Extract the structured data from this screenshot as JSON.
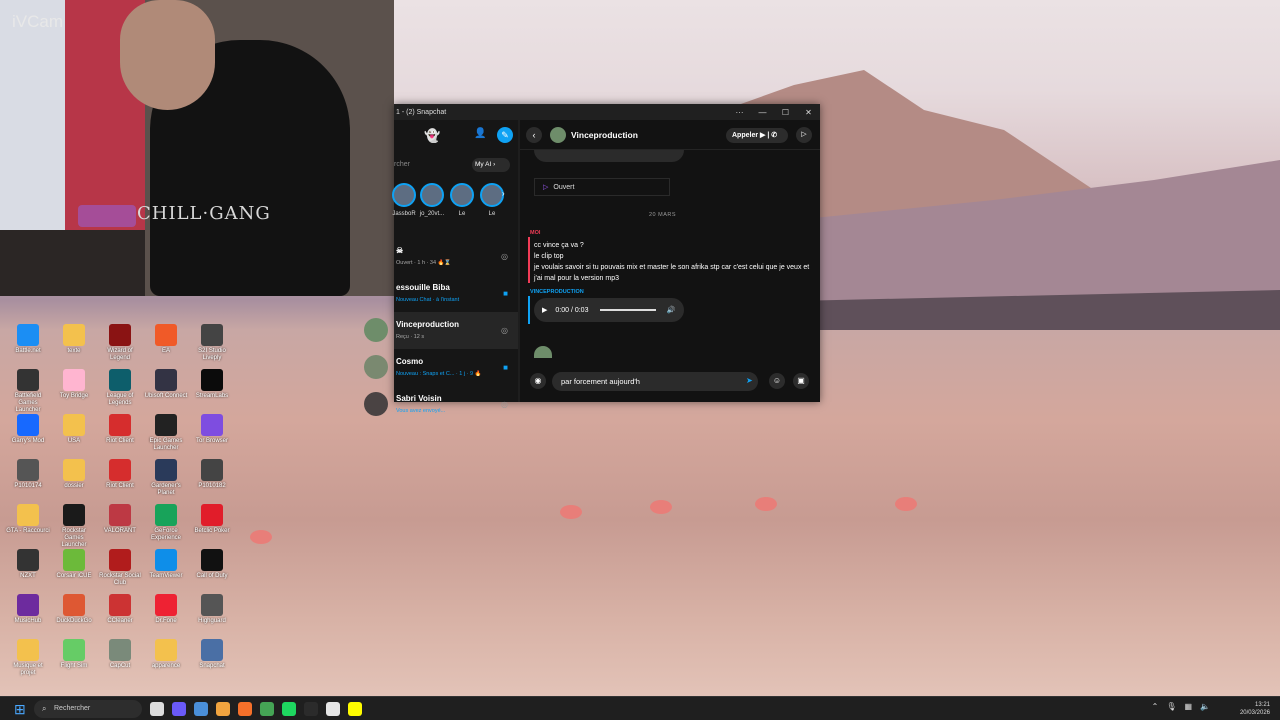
{
  "webcam": {
    "label": "iVCam",
    "shirt_text": "CHILL·GANG"
  },
  "desktop": {
    "icons": [
      {
        "label": "Battle.net",
        "color": "#1b8ef4"
      },
      {
        "label": "texte",
        "color": "#f3c14d"
      },
      {
        "label": "Wizard of Legend",
        "color": "#8a1313"
      },
      {
        "label": "EA",
        "color": "#f05a28"
      },
      {
        "label": "S2I Studio Liveply",
        "color": "#444"
      },
      {
        "label": "Battlefield Games Launcher",
        "color": "#333"
      },
      {
        "label": "Toy Bridge",
        "color": "#ffb5d0"
      },
      {
        "label": "League of Legends",
        "color": "#0d5e6b"
      },
      {
        "label": "Ubisoft Connect",
        "color": "#334"
      },
      {
        "label": "StreamLabs",
        "color": "#0b0b0b"
      },
      {
        "label": "Garry's Mod",
        "color": "#1769ff"
      },
      {
        "label": "USA",
        "color": "#f3c14d"
      },
      {
        "label": "Riot Client",
        "color": "#d62d2d"
      },
      {
        "label": "Epic Games Launcher",
        "color": "#222"
      },
      {
        "label": "Tor Browser",
        "color": "#7e4de0"
      },
      {
        "label": "P1010174",
        "color": "#555"
      },
      {
        "label": "dossier",
        "color": "#f3c14d"
      },
      {
        "label": "Riot Client",
        "color": "#d62d2d"
      },
      {
        "label": "Gardener's Planet",
        "color": "#2a3a5a"
      },
      {
        "label": "P1010182",
        "color": "#444"
      },
      {
        "label": "GTA - Raccourci",
        "color": "#f3c14d"
      },
      {
        "label": "Rockstar Games Launcher",
        "color": "#1a1a1a"
      },
      {
        "label": "VALORANT",
        "color": "#bd3944"
      },
      {
        "label": "GeForce Experience",
        "color": "#18a35a"
      },
      {
        "label": "Betclic Poker",
        "color": "#e11d2a"
      },
      {
        "label": "NZXT",
        "color": "#333"
      },
      {
        "label": "Corsair iCUE",
        "color": "#6cba3a"
      },
      {
        "label": "Rockstar Social Club",
        "color": "#b11c1c"
      },
      {
        "label": "TeamViewer",
        "color": "#0e8ee9"
      },
      {
        "label": "Call of Duty",
        "color": "#111"
      },
      {
        "label": "MusicHub",
        "color": "#6d2b9e"
      },
      {
        "label": "DuckDuckGo",
        "color": "#de5833"
      },
      {
        "label": "CCleaner",
        "color": "#c33"
      },
      {
        "label": "Dr.Fone",
        "color": "#e23"
      },
      {
        "label": "Highguard",
        "color": "#555"
      },
      {
        "label": "Musique et projet",
        "color": "#f3c14d"
      },
      {
        "label": "Flight Sim",
        "color": "#6c6"
      },
      {
        "label": "CapCut",
        "color": "#7a8a7a"
      },
      {
        "label": "apparence",
        "color": "#f3c14d"
      },
      {
        "label": "Snapchat",
        "color": "#4a6fa5"
      }
    ]
  },
  "snapchat": {
    "title": "1 - (2) Snapchat",
    "window_controls": [
      "···",
      "—",
      "☐",
      "✕"
    ],
    "search_placeholder": "rcher",
    "myai_label": "My AI",
    "stories": [
      {
        "name": "JassboR"
      },
      {
        "name": "jo_20vt..."
      },
      {
        "name": "Le"
      },
      {
        "name": "Le"
      }
    ],
    "chats": [
      {
        "name": "☠",
        "status": "Ouvert · 1 h · 34 🔥⌛"
      },
      {
        "name": "essouille Biba",
        "status": "Nouveau Chat · à l'instant"
      },
      {
        "name": "Vinceproduction",
        "status": "Reçu · 12 s"
      },
      {
        "name": "Cosmo",
        "status": "Nouveau : Snaps et C... · 1 j · 9 🔥"
      },
      {
        "name": "Sabri Voisin",
        "status": "Vous avez envoyé..."
      }
    ],
    "conversation": {
      "contact": "Vinceproduction",
      "call_label": "Appeler",
      "opened_label": "Ouvert",
      "date_divider": "20 MARS",
      "me_label": "MOI",
      "my_message": "cc vince ça va ?\nle clip top\nje voulais savoir si tu pouvais mix et master le son afrika stp car c'est celui que je veux et j'ai mal pour la version mp3",
      "them_label": "VINCEPRODUCTION",
      "audio_time": "0:00 / 0:03",
      "composer_value": "par forcement aujourd'h"
    }
  },
  "taskbar": {
    "search_placeholder": "Rechercher",
    "time": "13:21",
    "date": "20/03/2026"
  }
}
